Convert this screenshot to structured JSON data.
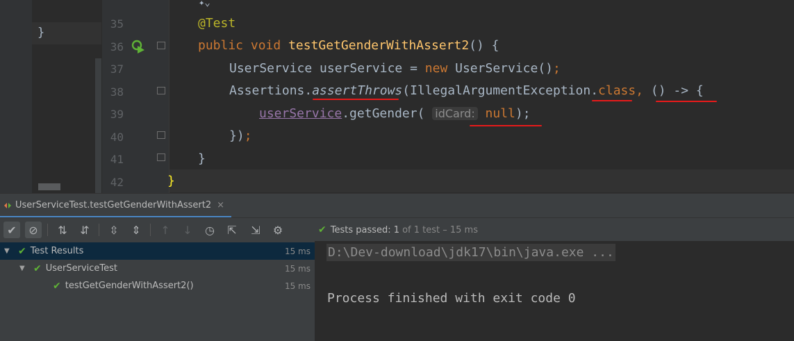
{
  "editor": {
    "prev_editor_text": "}",
    "line_numbers": [
      "35",
      "36",
      "37",
      "38",
      "39",
      "40",
      "41",
      "42"
    ],
    "code": {
      "l35_annotation": "@Test",
      "l36_kw1": "public",
      "l36_kw2": "void",
      "l36_method": "testGetGenderWithAssert2",
      "l36_rest": "() {",
      "l37_type": "UserService ",
      "l37_var": "userService",
      "l37_eq": " = ",
      "l37_new": "new",
      "l37_ctor": " UserService()",
      "l37_semi": ";",
      "l38_cls": "Assertions.",
      "l38_method": "assertThrows",
      "l38_arg": "(IllegalArgumentException.",
      "l38_kw": "class",
      "l38_comma": ", ",
      "l38_lambda": "() -> {",
      "l39_field": "userService",
      "l39_call": ".getGender(",
      "l39_hint": "idCard:",
      "l39_null": "null",
      "l39_end": ");",
      "l40_close": "})",
      "l40_semi": ";",
      "l41_close": "}",
      "l42_close": "}"
    }
  },
  "run_panel": {
    "tab_label": "UserServiceTest.testGetGenderWithAssert2",
    "tab_close": "×",
    "status_label": "Tests passed:",
    "status_value": "1",
    "status_detail": "of 1 test – 15 ms",
    "toolbar_icons": [
      "check-toggle-icon",
      "cancel-toggle-icon",
      "sort-alpha-icon",
      "sort-duration-icon",
      "expand-all-icon",
      "collapse-all-icon",
      "up-arrow-icon",
      "down-arrow-icon",
      "history-icon",
      "import-icon",
      "export-icon",
      "settings-icon"
    ]
  },
  "tree": {
    "rows": [
      {
        "label": "Test Results",
        "time": "15 ms"
      },
      {
        "label": "UserServiceTest",
        "time": "15 ms"
      },
      {
        "label": "testGetGenderWithAssert2()",
        "time": "15 ms"
      }
    ]
  },
  "console": {
    "command": "D:\\Dev-download\\jdk17\\bin\\java.exe ...",
    "exit_message": "Process finished with exit code 0"
  },
  "colors": {
    "keyword": "#cc7832",
    "annotation": "#bbb529",
    "method": "#ffc66d",
    "field": "#9876aa",
    "pass_green": "#5fb236",
    "underline_red": "#e81a1a"
  }
}
